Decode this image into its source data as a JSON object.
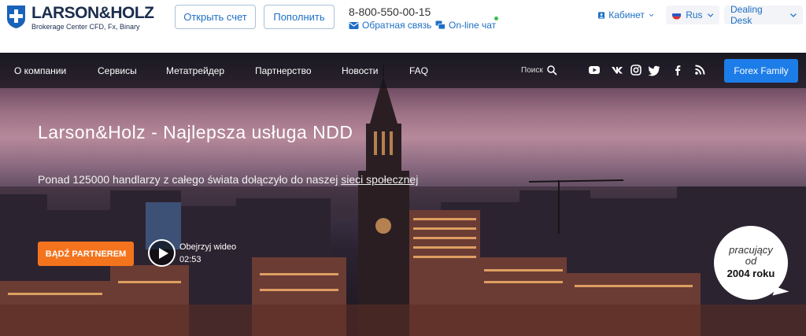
{
  "header": {
    "logo_name": "LARSON&HOLZ",
    "logo_tagline": "Brokerage Center CFD, Fx, Binary",
    "open_account": "Открыть счет",
    "deposit": "Пополнить",
    "phone": "8-800-550-00-15",
    "feedback": "Обратная связь",
    "online_chat": "On-line чат",
    "cabinet": "Кабинет",
    "language": "Rus",
    "dealing_desk": "Dealing Desk"
  },
  "nav": {
    "items": [
      "О компании",
      "Сервисы",
      "Метатрейдер",
      "Партнерство",
      "Новости",
      "FAQ"
    ],
    "search_label": "Поиск",
    "social_icons": [
      "youtube-icon",
      "vk-icon",
      "instagram-icon",
      "twitter-icon",
      "facebook-icon",
      "rss-icon"
    ],
    "forex_family": "Forex Family"
  },
  "hero": {
    "title": "Larson&Holz - Najlepsza usługa NDD",
    "subtitle_prefix": "Ponad 125000 handlarzy z całego świata dołączyło do naszej ",
    "subtitle_link": "sieci społecznej",
    "partner_button": "BĄDŹ PARTNEREM",
    "video_label": "Obejrzyj wideo",
    "video_time": "02:53",
    "badge_line1": "pracujący",
    "badge_line2": "od",
    "badge_line3": "2004 roku"
  },
  "colors": {
    "brand_navy": "#1a2d4d",
    "link_blue": "#1e6fc4",
    "accent_blue": "#1d7de8",
    "accent_orange": "#f4741e",
    "online_green": "#35c14a"
  }
}
